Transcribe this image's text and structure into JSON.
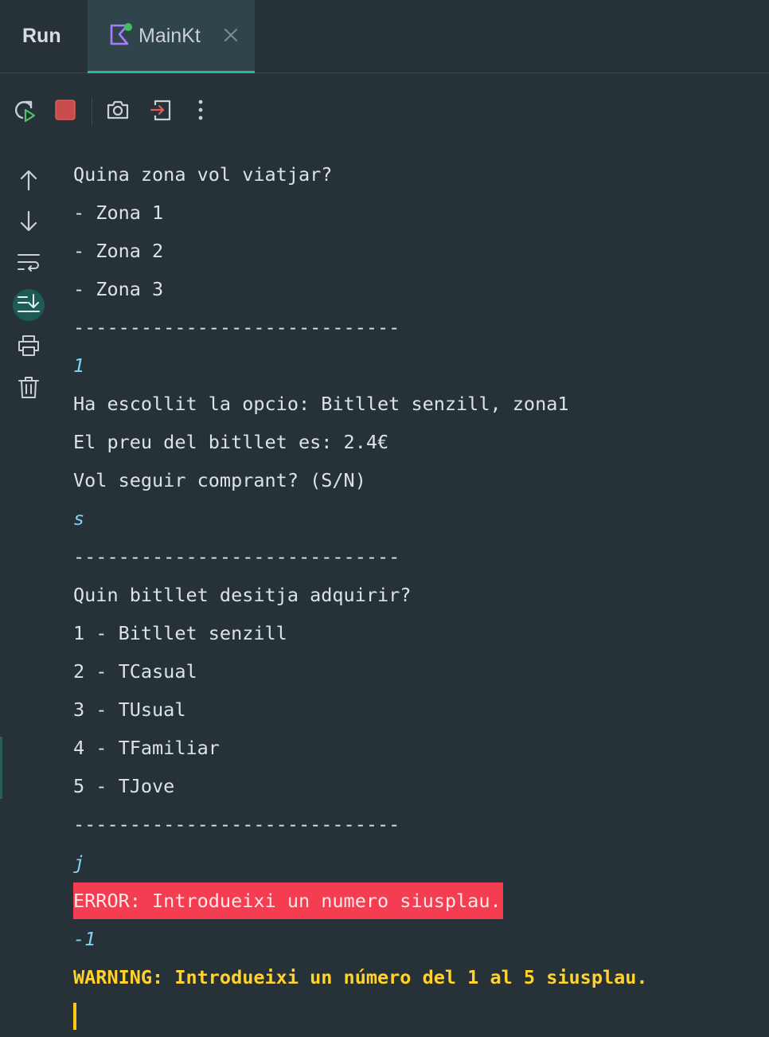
{
  "panel": {
    "title": "Run"
  },
  "tab": {
    "label": "MainKt",
    "icon": "kotlin-icon"
  },
  "toolbar": {
    "top": [
      "rerun-icon",
      "stop-icon",
      "screenshot-icon",
      "exit-icon",
      "more-options-icon"
    ],
    "side": [
      "arrow-up-icon",
      "arrow-down-icon",
      "soft-wrap-icon",
      "scroll-to-end-icon",
      "print-icon",
      "trash-icon"
    ]
  },
  "console": {
    "lines": [
      {
        "text": "Quina zona vol viatjar?",
        "kind": "output"
      },
      {
        "text": "- Zona 1",
        "kind": "output"
      },
      {
        "text": "- Zona 2",
        "kind": "output"
      },
      {
        "text": "- Zona 3",
        "kind": "output"
      },
      {
        "text": "-----------------------------",
        "kind": "output"
      },
      {
        "text": "1",
        "kind": "input"
      },
      {
        "text": "Ha escollit la opcio: Bitllet senzill, zona1",
        "kind": "output"
      },
      {
        "text": "El preu del bitllet es: 2.4€",
        "kind": "output"
      },
      {
        "text": "Vol seguir comprant? (S/N)",
        "kind": "output"
      },
      {
        "text": "s",
        "kind": "input"
      },
      {
        "text": "-----------------------------",
        "kind": "output"
      },
      {
        "text": "Quin bitllet desitja adquirir?",
        "kind": "output"
      },
      {
        "text": "1 - Bitllet senzill",
        "kind": "output"
      },
      {
        "text": "2 - TCasual",
        "kind": "output"
      },
      {
        "text": "3 - TUsual",
        "kind": "output"
      },
      {
        "text": "4 - TFamiliar",
        "kind": "output"
      },
      {
        "text": "5 - TJove",
        "kind": "output"
      },
      {
        "text": "-----------------------------",
        "kind": "output"
      },
      {
        "text": "j",
        "kind": "input"
      },
      {
        "text": "ERROR: Introdueixi un numero siusplau.",
        "kind": "error"
      },
      {
        "text": "-1",
        "kind": "input"
      },
      {
        "text": "WARNING: Introdueixi un número del 1 al 5 siusplau.",
        "kind": "warning"
      }
    ]
  },
  "colors": {
    "background": "#263238",
    "accent": "#2bb3a3",
    "input_text": "#7fd4f5",
    "error_bg": "#f53d52",
    "warning_text": "#ffd22e"
  }
}
